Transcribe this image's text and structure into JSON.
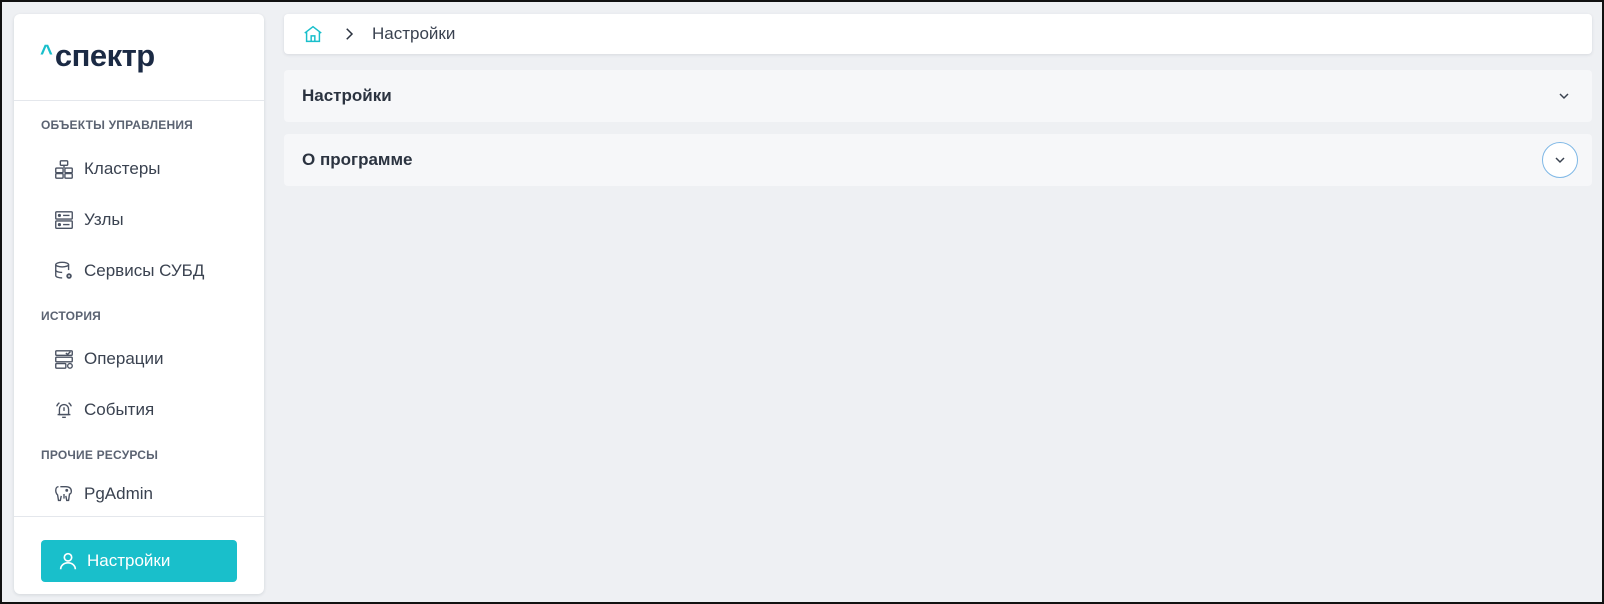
{
  "brand": {
    "logo_caret": "^",
    "logo_text": "спектр"
  },
  "sidebar": {
    "sections": [
      {
        "title": "ОБЪЕКТЫ УПРАВЛЕНИЯ",
        "items": [
          {
            "label": "Кластеры",
            "icon": "cluster-icon"
          },
          {
            "label": "Узлы",
            "icon": "server-icon"
          },
          {
            "label": "Сервисы СУБД",
            "icon": "database-gear-icon"
          }
        ]
      },
      {
        "title": "ИСТОРИЯ",
        "items": [
          {
            "label": "Операции",
            "icon": "operations-icon"
          },
          {
            "label": "События",
            "icon": "alarm-bell-icon"
          }
        ]
      },
      {
        "title": "ПРОЧИЕ РЕСУРСЫ",
        "items": [
          {
            "label": "PgAdmin",
            "icon": "elephant-icon"
          }
        ]
      }
    ],
    "settings_button": {
      "label": "Настройки",
      "icon": "user-icon"
    }
  },
  "breadcrumb": {
    "home_icon": "home-icon",
    "current": "Настройки"
  },
  "panels": [
    {
      "title": "Настройки",
      "expanded": false
    },
    {
      "title": "О программе",
      "expanded": false,
      "focused": true
    }
  ],
  "colors": {
    "accent": "#19bfcb",
    "brand_dark": "#1b2a44",
    "background": "#eef0f3"
  }
}
